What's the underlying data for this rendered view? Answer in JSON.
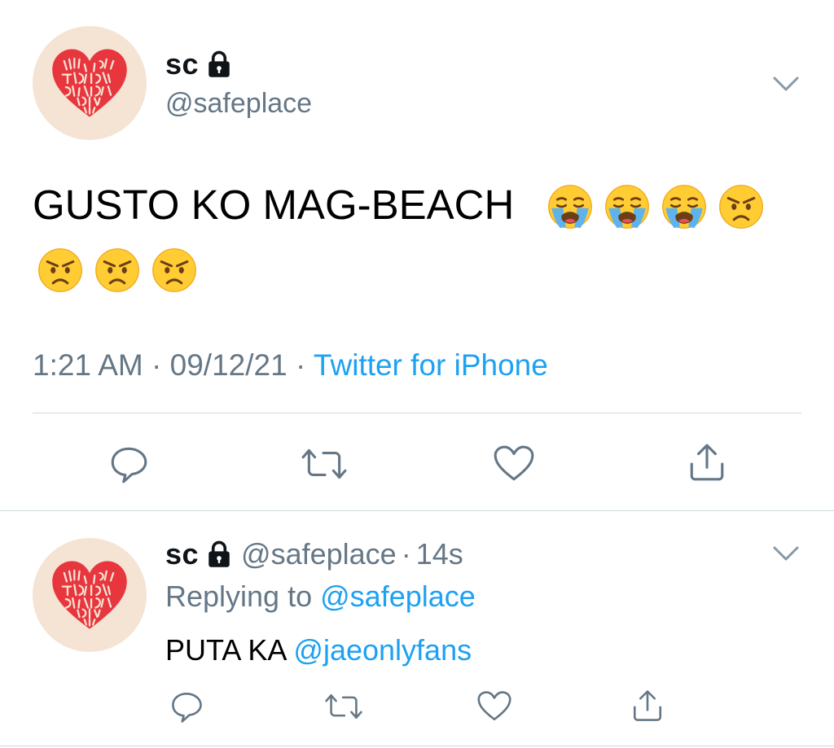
{
  "main_tweet": {
    "author": {
      "name": "sc",
      "handle": "@safeplace",
      "protected": true,
      "avatar_text": "BUT LOVE IS BLIND & LOVERS CANNOT SEE"
    },
    "text": "GUSTO KO MAG-BEACH",
    "emojis": [
      "loudly-crying-face",
      "loudly-crying-face",
      "loudly-crying-face",
      "angry-face",
      "angry-face",
      "angry-face",
      "angry-face"
    ],
    "time": "1:21 AM",
    "date": "09/12/21",
    "separator": "·",
    "source": "Twitter for iPhone",
    "actions": [
      "reply-icon",
      "retweet-icon",
      "like-icon",
      "share-icon"
    ]
  },
  "reply_tweet": {
    "author": {
      "name": "sc",
      "handle": "@safeplace",
      "protected": true
    },
    "time_ago": "14s",
    "separator": "·",
    "replying_prefix": "Replying to",
    "replying_to": "@safeplace",
    "text": "PUTA KA",
    "mention": "@jaeonlyfans",
    "actions": [
      "reply-icon",
      "retweet-icon",
      "like-icon",
      "share-icon"
    ]
  },
  "colors": {
    "link": "#1da1f2",
    "muted": "#657786",
    "divider": "#cfd9de",
    "avatar_bg": "#f5e3d3",
    "heart": "#e8363f"
  }
}
